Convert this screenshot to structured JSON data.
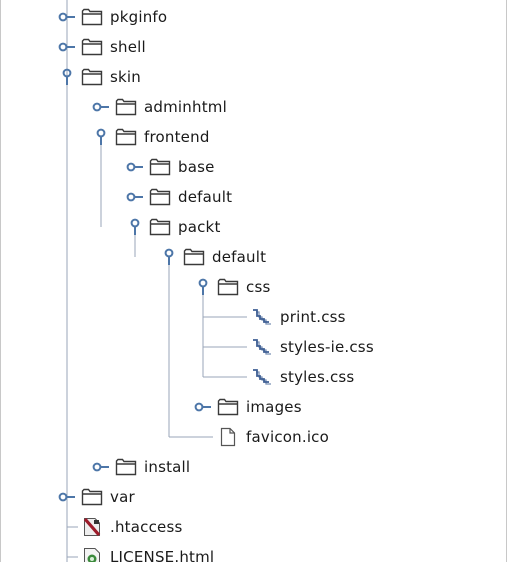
{
  "tree": {
    "items": [
      {
        "label": "pkginfo",
        "kind": "folder",
        "state": "collapsed",
        "depth": 0
      },
      {
        "label": "shell",
        "kind": "folder",
        "state": "collapsed",
        "depth": 0
      },
      {
        "label": "skin",
        "kind": "folder",
        "state": "expanded",
        "depth": 0
      },
      {
        "label": "adminhtml",
        "kind": "folder",
        "state": "collapsed",
        "depth": 1
      },
      {
        "label": "frontend",
        "kind": "folder",
        "state": "expanded",
        "depth": 1
      },
      {
        "label": "base",
        "kind": "folder",
        "state": "collapsed",
        "depth": 2
      },
      {
        "label": "default",
        "kind": "folder",
        "state": "collapsed",
        "depth": 2
      },
      {
        "label": "packt",
        "kind": "folder",
        "state": "expanded",
        "depth": 2
      },
      {
        "label": "default",
        "kind": "folder",
        "state": "expanded",
        "depth": 3
      },
      {
        "label": "css",
        "kind": "folder",
        "state": "expanded",
        "depth": 4
      },
      {
        "label": "print.css",
        "kind": "css-file",
        "state": "leaf",
        "depth": 5
      },
      {
        "label": "styles-ie.css",
        "kind": "css-file",
        "state": "leaf",
        "depth": 5
      },
      {
        "label": "styles.css",
        "kind": "css-file",
        "state": "leaf",
        "depth": 5
      },
      {
        "label": "images",
        "kind": "folder",
        "state": "collapsed",
        "depth": 4
      },
      {
        "label": "favicon.ico",
        "kind": "file",
        "state": "leaf",
        "depth": 4
      },
      {
        "label": "install",
        "kind": "folder",
        "state": "collapsed",
        "depth": 1
      },
      {
        "label": "var",
        "kind": "folder",
        "state": "collapsed",
        "depth": 0
      },
      {
        "label": ".htaccess",
        "kind": "htaccess-file",
        "state": "leaf",
        "depth": 0
      },
      {
        "label": "LICENSE.html",
        "kind": "html-file",
        "state": "leaf",
        "depth": 0
      }
    ]
  },
  "colors": {
    "guide_line": "#9aa6b8",
    "toggle": "#4d76a8",
    "folder_stroke": "#3a3a3a",
    "folder_fill": "#ffffff",
    "css_icon": "#3f5f94",
    "htaccess_icon": "#9c1b2a",
    "html_icon": "#3c8a3c"
  }
}
